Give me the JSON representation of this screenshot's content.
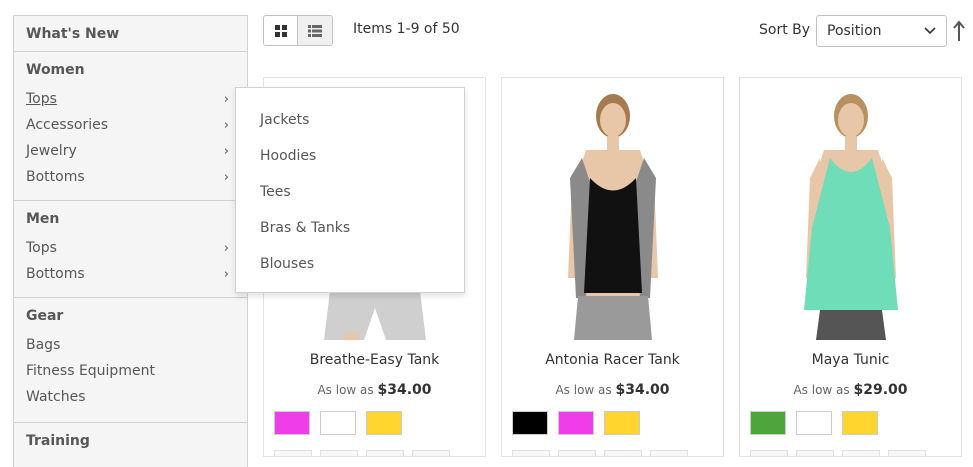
{
  "sidebar": {
    "whats_new": "What's New",
    "women": {
      "title": "Women",
      "items": [
        {
          "label": "Tops",
          "has_sub": true
        },
        {
          "label": "Accessories",
          "has_sub": true
        },
        {
          "label": "Jewelry",
          "has_sub": true
        },
        {
          "label": "Bottoms",
          "has_sub": true
        }
      ]
    },
    "men": {
      "title": "Men",
      "items": [
        {
          "label": "Tops",
          "has_sub": true
        },
        {
          "label": "Bottoms",
          "has_sub": true
        }
      ]
    },
    "gear": {
      "title": "Gear",
      "items": [
        {
          "label": "Bags"
        },
        {
          "label": "Fitness Equipment"
        },
        {
          "label": "Watches"
        }
      ]
    },
    "training": {
      "title": "Training"
    }
  },
  "flyout": {
    "items": [
      "Jackets",
      "Hoodies",
      "Tees",
      "Bras & Tanks",
      "Blouses"
    ]
  },
  "toolbar": {
    "items_count": "Items 1-9 of 50",
    "sort_label": "Sort By",
    "sort_value": "Position"
  },
  "products": [
    {
      "name": "Breathe-Easy Tank",
      "price_prefix": "As low as",
      "price": "$34.00",
      "top_color": "#9ea3a8",
      "swatches": [
        "#ef3dea",
        "#ffffff",
        "#ffd52e"
      ]
    },
    {
      "name": "Antonia Racer Tank",
      "price_prefix": "As low as",
      "price": "$34.00",
      "top_color": "#111111",
      "swatches": [
        "#000000",
        "#ef3dea",
        "#ffd52e"
      ]
    },
    {
      "name": "Maya Tunic",
      "price_prefix": "As low as",
      "price": "$29.00",
      "top_color": "#6fddb8",
      "swatches": [
        "#4ea53b",
        "#ffffff",
        "#ffd52e"
      ]
    }
  ]
}
